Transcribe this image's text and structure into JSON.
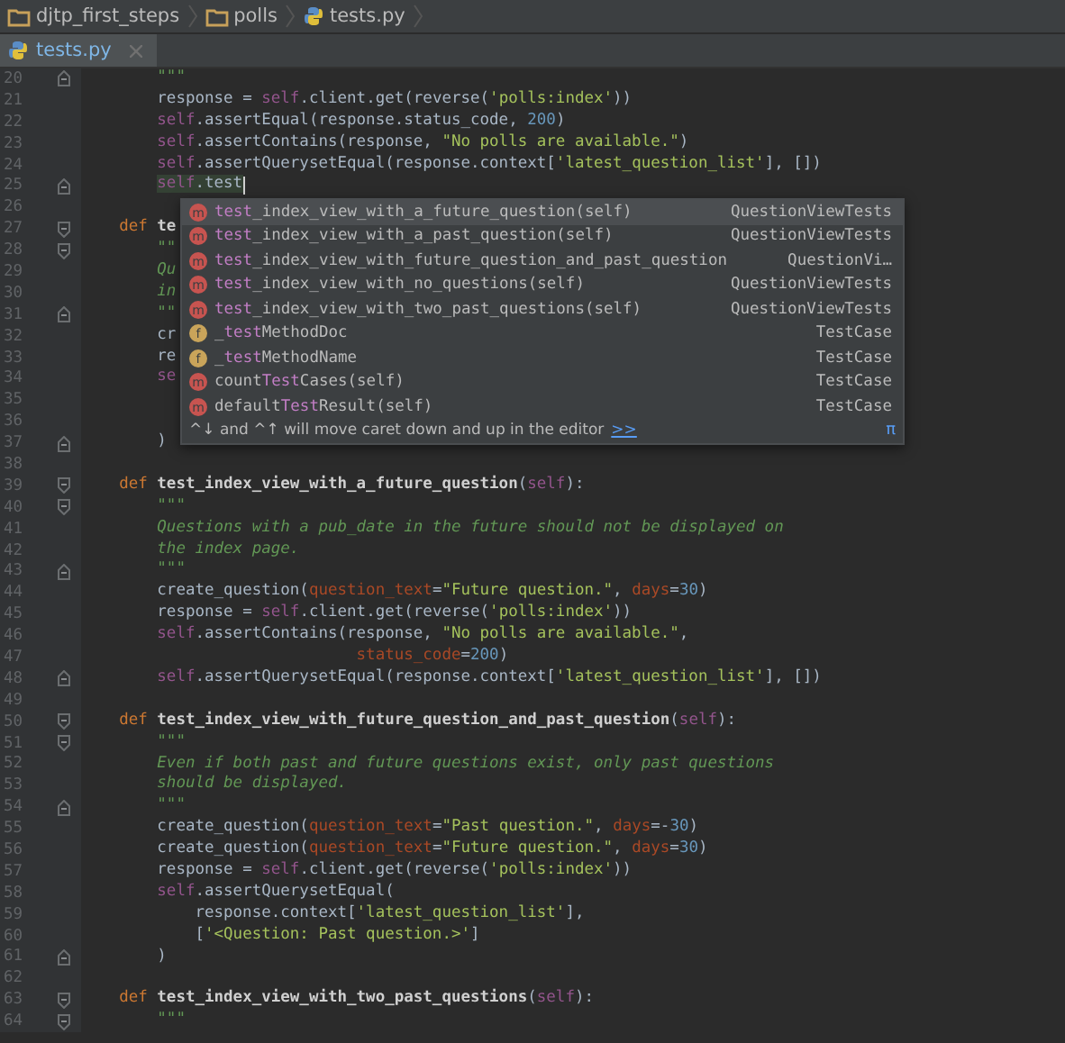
{
  "breadcrumbs": [
    {
      "kind": "folder",
      "label": "djtp_first_steps"
    },
    {
      "kind": "folder",
      "label": "polls"
    },
    {
      "kind": "python",
      "label": "tests.py"
    }
  ],
  "tabs": [
    {
      "label": "tests.py",
      "selected": true
    }
  ],
  "editor": {
    "lines": [
      {
        "number": "20",
        "fold": {
          "kind": "end"
        },
        "tokens": [
          {
            "kind": "doc",
            "text": "        \"\"\""
          }
        ]
      },
      {
        "number": "21",
        "tokens": [
          {
            "kind": "plain",
            "text": "        response = "
          },
          {
            "kind": "self",
            "text": "self"
          },
          {
            "kind": "plain",
            "text": ".client.get(reverse("
          },
          {
            "kind": "string",
            "text": "'polls:index'"
          },
          {
            "kind": "plain",
            "text": "))"
          }
        ]
      },
      {
        "number": "22",
        "tokens": [
          {
            "kind": "self",
            "text": "        self"
          },
          {
            "kind": "plain",
            "text": ".assertEqual(response.status_code, "
          },
          {
            "kind": "number",
            "text": "200"
          },
          {
            "kind": "plain",
            "text": ")"
          }
        ]
      },
      {
        "number": "23",
        "tokens": [
          {
            "kind": "self",
            "text": "        self"
          },
          {
            "kind": "plain",
            "text": ".assertContains(response, "
          },
          {
            "kind": "string",
            "text": "\"No polls are available.\""
          },
          {
            "kind": "plain",
            "text": ")"
          }
        ]
      },
      {
        "number": "24",
        "tokens": [
          {
            "kind": "self",
            "text": "        self"
          },
          {
            "kind": "plain",
            "text": ".assertQuerysetEqual(response.context["
          },
          {
            "kind": "string",
            "text": "'latest_question_list'"
          },
          {
            "kind": "plain",
            "text": "], [])"
          }
        ]
      },
      {
        "number": "25",
        "fold": {
          "kind": "end"
        },
        "caret": true,
        "tokens": [
          {
            "kind": "usage_self",
            "text": "        self"
          },
          {
            "kind": "usage",
            "text": ".test"
          }
        ]
      },
      {
        "number": "26"
      },
      {
        "number": "27",
        "fold": {
          "kind": "start"
        },
        "tokens": [
          {
            "kind": "keyword",
            "text": "    def "
          },
          {
            "kind": "def_name",
            "text": "te"
          }
        ]
      },
      {
        "number": "28",
        "fold": {
          "kind": "start"
        },
        "tokens": [
          {
            "kind": "doc",
            "text": "        \"\""
          }
        ]
      },
      {
        "number": "29",
        "tokens": [
          {
            "kind": "doc",
            "text": "        Qu"
          }
        ]
      },
      {
        "number": "30",
        "tokens": [
          {
            "kind": "doc",
            "text": "        in"
          }
        ]
      },
      {
        "number": "31",
        "fold": {
          "kind": "end"
        },
        "tokens": [
          {
            "kind": "doc",
            "text": "        \"\""
          }
        ]
      },
      {
        "number": "32",
        "tokens": [
          {
            "kind": "plain",
            "text": "        cr"
          }
        ]
      },
      {
        "number": "33",
        "tokens": [
          {
            "kind": "plain",
            "text": "        re"
          }
        ]
      },
      {
        "number": "34",
        "tokens": [
          {
            "kind": "self",
            "text": "        se"
          }
        ]
      },
      {
        "number": "35"
      },
      {
        "number": "36"
      },
      {
        "number": "37",
        "fold": {
          "kind": "end"
        },
        "tokens": [
          {
            "kind": "plain",
            "text": "        )"
          }
        ]
      },
      {
        "number": "38"
      },
      {
        "number": "39",
        "fold": {
          "kind": "start"
        },
        "tokens": [
          {
            "kind": "keyword",
            "text": "    def "
          },
          {
            "kind": "def_name",
            "text": "test_index_view_with_a_future_question"
          },
          {
            "kind": "plain",
            "text": "("
          },
          {
            "kind": "self",
            "text": "self"
          },
          {
            "kind": "plain",
            "text": "):"
          }
        ]
      },
      {
        "number": "40",
        "fold": {
          "kind": "start"
        },
        "tokens": [
          {
            "kind": "doc",
            "text": "        \"\"\""
          }
        ]
      },
      {
        "number": "41",
        "tokens": [
          {
            "kind": "doc",
            "text": "        Questions with a pub_date in the future should not be displayed on"
          }
        ]
      },
      {
        "number": "42",
        "tokens": [
          {
            "kind": "doc",
            "text": "        the index page."
          }
        ]
      },
      {
        "number": "43",
        "fold": {
          "kind": "end"
        },
        "tokens": [
          {
            "kind": "doc",
            "text": "        \"\"\""
          }
        ]
      },
      {
        "number": "44",
        "tokens": [
          {
            "kind": "plain",
            "text": "        create_question("
          },
          {
            "kind": "param",
            "text": "question_text"
          },
          {
            "kind": "plain",
            "text": "="
          },
          {
            "kind": "string",
            "text": "\"Future question.\""
          },
          {
            "kind": "plain",
            "text": ", "
          },
          {
            "kind": "param",
            "text": "days"
          },
          {
            "kind": "plain",
            "text": "="
          },
          {
            "kind": "number",
            "text": "30"
          },
          {
            "kind": "plain",
            "text": ")"
          }
        ]
      },
      {
        "number": "45",
        "tokens": [
          {
            "kind": "plain",
            "text": "        response = "
          },
          {
            "kind": "self",
            "text": "self"
          },
          {
            "kind": "plain",
            "text": ".client.get(reverse("
          },
          {
            "kind": "string",
            "text": "'polls:index'"
          },
          {
            "kind": "plain",
            "text": "))"
          }
        ]
      },
      {
        "number": "46",
        "tokens": [
          {
            "kind": "self",
            "text": "        self"
          },
          {
            "kind": "plain",
            "text": ".assertContains(response, "
          },
          {
            "kind": "string",
            "text": "\"No polls are available.\""
          },
          {
            "kind": "plain",
            "text": ","
          }
        ]
      },
      {
        "number": "47",
        "tokens": [
          {
            "kind": "param",
            "text": "                             status_code"
          },
          {
            "kind": "plain",
            "text": "="
          },
          {
            "kind": "number",
            "text": "200"
          },
          {
            "kind": "plain",
            "text": ")"
          }
        ]
      },
      {
        "number": "48",
        "fold": {
          "kind": "end"
        },
        "tokens": [
          {
            "kind": "self",
            "text": "        self"
          },
          {
            "kind": "plain",
            "text": ".assertQuerysetEqual(response.context["
          },
          {
            "kind": "string",
            "text": "'latest_question_list'"
          },
          {
            "kind": "plain",
            "text": "], [])"
          }
        ]
      },
      {
        "number": "49"
      },
      {
        "number": "50",
        "fold": {
          "kind": "start"
        },
        "tokens": [
          {
            "kind": "keyword",
            "text": "    def "
          },
          {
            "kind": "def_name",
            "text": "test_index_view_with_future_question_and_past_question"
          },
          {
            "kind": "plain",
            "text": "("
          },
          {
            "kind": "self",
            "text": "self"
          },
          {
            "kind": "plain",
            "text": "):"
          }
        ]
      },
      {
        "number": "51",
        "fold": {
          "kind": "start"
        },
        "tokens": [
          {
            "kind": "doc",
            "text": "        \"\"\""
          }
        ]
      },
      {
        "number": "52",
        "tokens": [
          {
            "kind": "doc",
            "text": "        Even if both past and future questions exist, only past questions"
          }
        ]
      },
      {
        "number": "53",
        "tokens": [
          {
            "kind": "doc",
            "text": "        should be displayed."
          }
        ]
      },
      {
        "number": "54",
        "fold": {
          "kind": "end"
        },
        "tokens": [
          {
            "kind": "doc",
            "text": "        \"\"\""
          }
        ]
      },
      {
        "number": "55",
        "tokens": [
          {
            "kind": "plain",
            "text": "        create_question("
          },
          {
            "kind": "param",
            "text": "question_text"
          },
          {
            "kind": "plain",
            "text": "="
          },
          {
            "kind": "string",
            "text": "\"Past question.\""
          },
          {
            "kind": "plain",
            "text": ", "
          },
          {
            "kind": "param",
            "text": "days"
          },
          {
            "kind": "plain",
            "text": "=-"
          },
          {
            "kind": "number",
            "text": "30"
          },
          {
            "kind": "plain",
            "text": ")"
          }
        ]
      },
      {
        "number": "56",
        "tokens": [
          {
            "kind": "plain",
            "text": "        create_question("
          },
          {
            "kind": "param",
            "text": "question_text"
          },
          {
            "kind": "plain",
            "text": "="
          },
          {
            "kind": "string",
            "text": "\"Future question.\""
          },
          {
            "kind": "plain",
            "text": ", "
          },
          {
            "kind": "param",
            "text": "days"
          },
          {
            "kind": "plain",
            "text": "="
          },
          {
            "kind": "number",
            "text": "30"
          },
          {
            "kind": "plain",
            "text": ")"
          }
        ]
      },
      {
        "number": "57",
        "tokens": [
          {
            "kind": "plain",
            "text": "        response = "
          },
          {
            "kind": "self",
            "text": "self"
          },
          {
            "kind": "plain",
            "text": ".client.get(reverse("
          },
          {
            "kind": "string",
            "text": "'polls:index'"
          },
          {
            "kind": "plain",
            "text": "))"
          }
        ]
      },
      {
        "number": "58",
        "tokens": [
          {
            "kind": "self",
            "text": "        self"
          },
          {
            "kind": "plain",
            "text": ".assertQuerysetEqual("
          }
        ]
      },
      {
        "number": "59",
        "tokens": [
          {
            "kind": "plain",
            "text": "            response.context["
          },
          {
            "kind": "string",
            "text": "'latest_question_list'"
          },
          {
            "kind": "plain",
            "text": "],"
          }
        ]
      },
      {
        "number": "60",
        "tokens": [
          {
            "kind": "plain",
            "text": "            ["
          },
          {
            "kind": "string",
            "text": "'<Question: Past question.>'"
          },
          {
            "kind": "plain",
            "text": "]"
          }
        ]
      },
      {
        "number": "61",
        "fold": {
          "kind": "end"
        },
        "tokens": [
          {
            "kind": "plain",
            "text": "        )"
          }
        ]
      },
      {
        "number": "62"
      },
      {
        "number": "63",
        "fold": {
          "kind": "start"
        },
        "tokens": [
          {
            "kind": "keyword",
            "text": "    def "
          },
          {
            "kind": "def_name",
            "text": "test_index_view_with_two_past_questions"
          },
          {
            "kind": "plain",
            "text": "("
          },
          {
            "kind": "self",
            "text": "self"
          },
          {
            "kind": "plain",
            "text": "):"
          }
        ]
      },
      {
        "number": "64",
        "fold": {
          "kind": "start"
        },
        "tokens": [
          {
            "kind": "doc",
            "text": "        \"\"\""
          }
        ]
      }
    ]
  },
  "completion": {
    "items": [
      {
        "kind": "m",
        "selected": true,
        "name": [
          {
            "text": "test",
            "match": true
          },
          {
            "text": "_index_view_with_a_future_question(self)",
            "match": false
          }
        ],
        "type": "QuestionViewTests"
      },
      {
        "kind": "m",
        "selected": false,
        "name": [
          {
            "text": "test",
            "match": true
          },
          {
            "text": "_index_view_with_a_past_question(self)",
            "match": false
          }
        ],
        "type": "QuestionViewTests"
      },
      {
        "kind": "m",
        "selected": false,
        "name": [
          {
            "text": "test",
            "match": true
          },
          {
            "text": "_index_view_with_future_question_and_past_question",
            "match": false
          }
        ],
        "type": "QuestionVi…"
      },
      {
        "kind": "m",
        "selected": false,
        "name": [
          {
            "text": "test",
            "match": true
          },
          {
            "text": "_index_view_with_no_questions(self)",
            "match": false
          }
        ],
        "type": "QuestionViewTests"
      },
      {
        "kind": "m",
        "selected": false,
        "name": [
          {
            "text": "test",
            "match": true
          },
          {
            "text": "_index_view_with_two_past_questions(self)",
            "match": false
          }
        ],
        "type": "QuestionViewTests"
      },
      {
        "kind": "f",
        "selected": false,
        "name": [
          {
            "text": "_",
            "match": false
          },
          {
            "text": "test",
            "match": true
          },
          {
            "text": "MethodDoc",
            "match": false
          }
        ],
        "type": "TestCase"
      },
      {
        "kind": "f",
        "selected": false,
        "name": [
          {
            "text": "_",
            "match": false
          },
          {
            "text": "test",
            "match": true
          },
          {
            "text": "MethodName",
            "match": false
          }
        ],
        "type": "TestCase"
      },
      {
        "kind": "m",
        "selected": false,
        "name": [
          {
            "text": "count",
            "match": false
          },
          {
            "text": "Test",
            "match": true
          },
          {
            "text": "Cases(self)",
            "match": false
          }
        ],
        "type": "TestCase"
      },
      {
        "kind": "m",
        "selected": false,
        "name": [
          {
            "text": "default",
            "match": false
          },
          {
            "text": "Test",
            "match": true
          },
          {
            "text": "Result(self)",
            "match": false
          }
        ],
        "type": "TestCase"
      }
    ],
    "hint": "^↓ and ^↑ will move caret down and up in the editor",
    "hint_link": ">>",
    "pin": "π"
  }
}
